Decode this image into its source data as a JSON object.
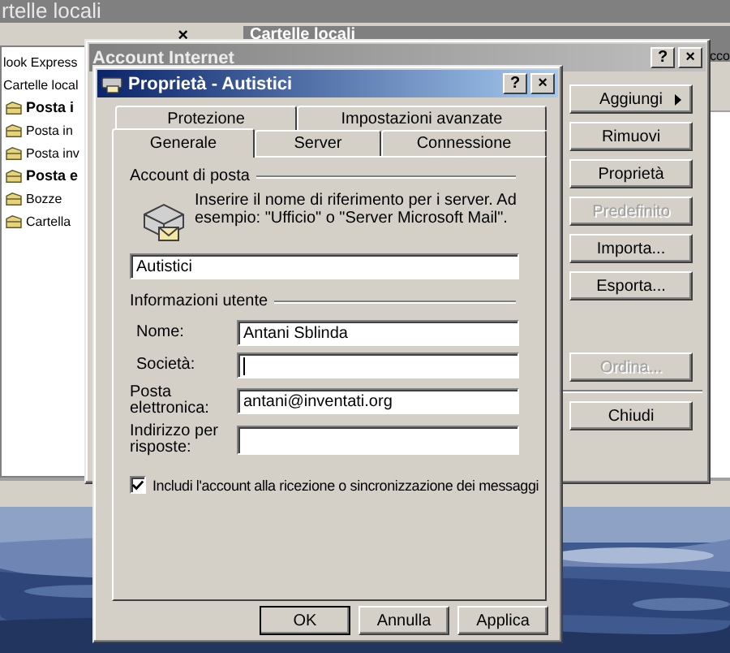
{
  "background_window": {
    "title": "rtelle locali",
    "folder_pane": {
      "close": "×",
      "items": [
        {
          "label": "look Express",
          "unread": false,
          "kind": "root"
        },
        {
          "label": "Cartelle local",
          "unread": false,
          "kind": "root"
        },
        {
          "label": "Posta i",
          "unread": true,
          "kind": "folder"
        },
        {
          "label": "Posta in",
          "unread": false,
          "kind": "folder"
        },
        {
          "label": "Posta inv",
          "unread": false,
          "kind": "folder"
        },
        {
          "label": "Posta e",
          "unread": true,
          "kind": "folder"
        },
        {
          "label": "Bozze",
          "unread": false,
          "kind": "folder"
        },
        {
          "label": "Cartella",
          "unread": false,
          "kind": "folder"
        }
      ]
    },
    "content_header": "Cartelle locali",
    "edge_text": "cco"
  },
  "accounts_window": {
    "title": "Account Internet",
    "help": "?",
    "close": "×",
    "buttons": [
      {
        "label": "Aggiungi",
        "disabled": false,
        "kind": "menu"
      },
      {
        "label": "Rimuovi",
        "disabled": false,
        "kind": "plain"
      },
      {
        "label": "Proprietà",
        "disabled": false,
        "kind": "plain"
      },
      {
        "label": "Predefinito",
        "disabled": true,
        "kind": "plain"
      },
      {
        "label": "Importa...",
        "disabled": false,
        "kind": "plain"
      },
      {
        "label": "Esporta...",
        "disabled": false,
        "kind": "plain"
      },
      {
        "label": "Ordina...",
        "disabled": true,
        "kind": "gap"
      },
      {
        "label": "Chiudi",
        "disabled": false,
        "kind": "separated"
      }
    ]
  },
  "properties_dialog": {
    "title": "Proprietà - Autistici",
    "help": "?",
    "close": "×",
    "tabs_back": [
      {
        "label": "Protezione",
        "selected": false
      },
      {
        "label": "Impostazioni avanzate",
        "selected": false
      }
    ],
    "tabs_front": [
      {
        "label": "Generale",
        "selected": true
      },
      {
        "label": "Server",
        "selected": false
      },
      {
        "label": "Connessione",
        "selected": false
      }
    ],
    "mail_account": {
      "heading": "Account di posta",
      "description": "Inserire il nome di riferimento per i server. Ad esempio: \"Ufficio\" o \"Server Microsoft Mail\".",
      "value": "Autistici"
    },
    "user_info": {
      "heading": "Informazioni utente",
      "fields": [
        {
          "label": "Nome:",
          "value": "Antani Sblinda",
          "focused": false
        },
        {
          "label": "Società:",
          "focused": true
        },
        {
          "label": "Posta elettronica:",
          "value": "antani@inventati.org",
          "focused": false
        },
        {
          "label": "Indirizzo per risposte:",
          "focused": false
        }
      ]
    },
    "include_option": {
      "label": "Includi l'account alla ricezione o sincronizzazione dei messaggi",
      "checked": true
    },
    "buttons": [
      {
        "label": "OK",
        "default": true
      },
      {
        "label": "Annulla",
        "default": false
      },
      {
        "label": "Applica",
        "default": false
      }
    ]
  }
}
